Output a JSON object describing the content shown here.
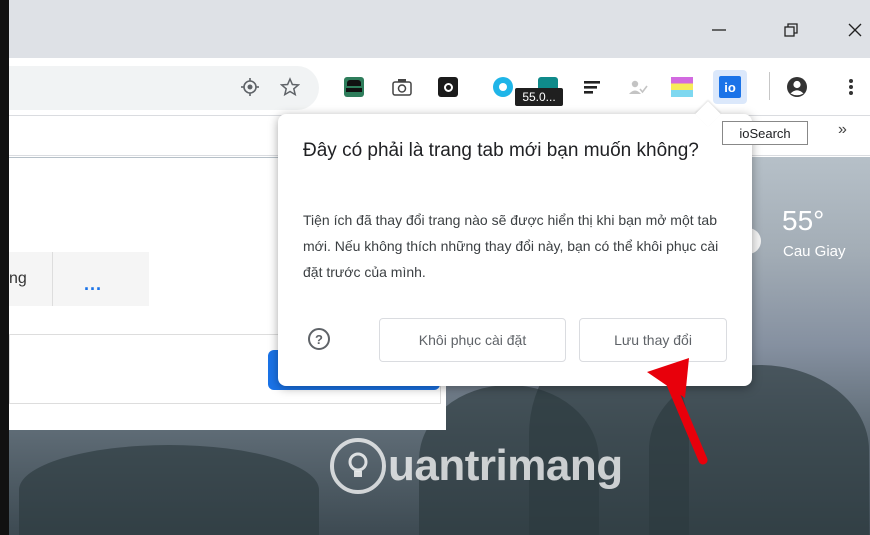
{
  "browser": {
    "badge_text": "55.0...",
    "tooltip": "ioSearch",
    "extension_label": "io"
  },
  "popup": {
    "title": "Đây có phải là trang tab mới bạn muốn không?",
    "body": "Tiện ích đã thay đổi trang nào sẽ được hiển thị khi bạn mở một tab mới. Nếu không thích những thay đổi này, bạn có thể khôi phục cài đặt trước của mình.",
    "help_symbol": "?",
    "restore_button": "Khôi phục cài đặt",
    "keep_button": "Lưu thay đổi"
  },
  "page": {
    "partial_tab_text": "ng",
    "more_dots": "..."
  },
  "weather": {
    "temperature": "55°",
    "city": "Cau Giay"
  },
  "watermark": {
    "text": "uantrimang"
  },
  "colors": {
    "accent": "#1a73e8",
    "annotation_arrow": "#e8000b"
  }
}
